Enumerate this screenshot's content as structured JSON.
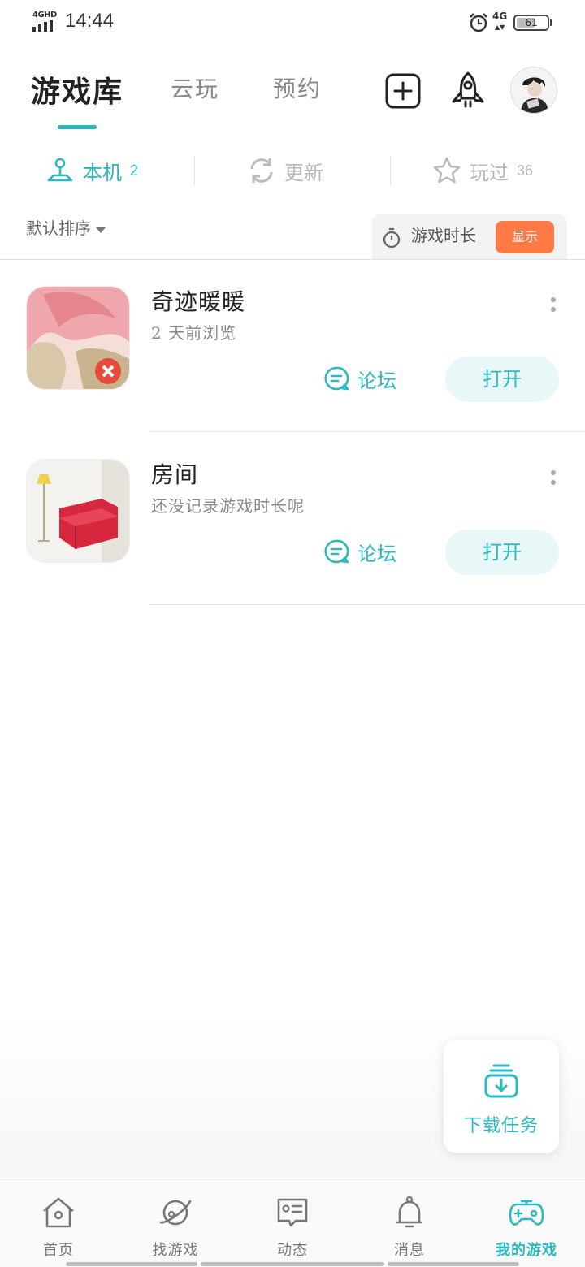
{
  "status_bar": {
    "network_tag": "4GHD",
    "time": "14:44",
    "network": "4G",
    "battery": "61",
    "battery_level": 0.61
  },
  "header": {
    "tabs": [
      {
        "label": "游戏库",
        "active": true
      },
      {
        "label": "云玩",
        "active": false
      },
      {
        "label": "预约",
        "active": false
      }
    ],
    "icons": [
      "add-square-icon",
      "rocket-icon",
      "avatar"
    ]
  },
  "subtabs": [
    {
      "label": "本机",
      "count": "2",
      "icon": "joystick-icon",
      "active": true
    },
    {
      "label": "更新",
      "count": "",
      "icon": "refresh-icon",
      "active": false
    },
    {
      "label": "玩过",
      "count": "36",
      "icon": "star-icon",
      "active": false
    }
  ],
  "sort": {
    "label": "默认排序"
  },
  "playtime": {
    "label": "游戏时长",
    "button": "显示"
  },
  "games": [
    {
      "title": "奇迹暖暖",
      "subtitle": "2 天前浏览",
      "forum": "论坛",
      "open": "打开"
    },
    {
      "title": "房间",
      "subtitle": "还没记录游戏时长呢",
      "forum": "论坛",
      "open": "打开"
    }
  ],
  "download": {
    "label": "下载任务"
  },
  "bottom_nav": [
    {
      "label": "首页",
      "icon": "home-icon",
      "active": false
    },
    {
      "label": "找游戏",
      "icon": "planet-icon",
      "active": false
    },
    {
      "label": "动态",
      "icon": "feed-icon",
      "active": false
    },
    {
      "label": "消息",
      "icon": "bell-icon",
      "active": false
    },
    {
      "label": "我的游戏",
      "icon": "gamepad-icon",
      "active": true
    }
  ],
  "colors": {
    "accent": "#2bb8c1",
    "orange": "#ff7a45",
    "text": "#222222",
    "muted": "#888888"
  }
}
